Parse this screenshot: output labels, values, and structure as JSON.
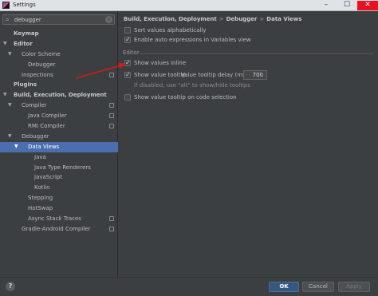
{
  "window": {
    "title": "Settings",
    "minimize": "–",
    "maximize": "☐",
    "close": "✕"
  },
  "search": {
    "value": "debugger",
    "icon": "search-icon",
    "clear": "×"
  },
  "tree": [
    {
      "label": "Keymap",
      "bold": true,
      "arrow": "",
      "indent": 0
    },
    {
      "label": "Editor",
      "bold": true,
      "arrow": "▼",
      "indent": 0
    },
    {
      "label": "Color Scheme",
      "bold": false,
      "arrow": "▼",
      "indent": 1
    },
    {
      "label": "Debugger",
      "bold": false,
      "arrow": "",
      "indent": 2
    },
    {
      "label": "Inspections",
      "bold": false,
      "arrow": "",
      "indent": 1,
      "project": true
    },
    {
      "label": "Plugins",
      "bold": true,
      "arrow": "",
      "indent": 0
    },
    {
      "label": "Build, Execution, Deployment",
      "bold": true,
      "arrow": "▼",
      "indent": 0
    },
    {
      "label": "Compiler",
      "bold": false,
      "arrow": "▼",
      "indent": 1,
      "project": true
    },
    {
      "label": "Java Compiler",
      "bold": false,
      "arrow": "",
      "indent": 2,
      "project": true
    },
    {
      "label": "RMI Compiler",
      "bold": false,
      "arrow": "",
      "indent": 2,
      "project": true
    },
    {
      "label": "Debugger",
      "bold": false,
      "arrow": "▼",
      "indent": 1
    },
    {
      "label": "Data Views",
      "bold": false,
      "arrow": "▼",
      "indent": 2,
      "selected": true
    },
    {
      "label": "Java",
      "bold": false,
      "arrow": "",
      "indent": 3
    },
    {
      "label": "Java Type Renderers",
      "bold": false,
      "arrow": "",
      "indent": 3
    },
    {
      "label": "JavaScript",
      "bold": false,
      "arrow": "",
      "indent": 3
    },
    {
      "label": "Kotlin",
      "bold": false,
      "arrow": "",
      "indent": 3
    },
    {
      "label": "Stepping",
      "bold": false,
      "arrow": "",
      "indent": 2
    },
    {
      "label": "HotSwap",
      "bold": false,
      "arrow": "",
      "indent": 2
    },
    {
      "label": "Async Stack Traces",
      "bold": false,
      "arrow": "",
      "indent": 2,
      "project": true
    },
    {
      "label": "Gradle-Android Compiler",
      "bold": false,
      "arrow": "",
      "indent": 1,
      "project": true
    }
  ],
  "breadcrumb": {
    "part1": "Build, Execution, Deployment",
    "part2": "Debugger",
    "part3": "Data Views",
    "sep": ">"
  },
  "options": {
    "sort_values": {
      "label": "Sort values alphabetically",
      "checked": false
    },
    "auto_expressions": {
      "label": "Enable auto expressions in Variables view",
      "checked": true
    }
  },
  "editor_section": {
    "title": "Editor",
    "show_inline": {
      "label": "Show values inline",
      "checked": true
    },
    "show_tooltip": {
      "label": "Show value tooltip.",
      "checked": true
    },
    "tooltip_delay_label": "Value tooltip delay (ms):",
    "tooltip_delay_value": "700",
    "hint": "If disabled, use \"alt\" to show/hide tooltips",
    "tooltip_on_selection": {
      "label": "Show value tooltip on code selection",
      "checked": false
    }
  },
  "buttons": {
    "help": "?",
    "ok": "OK",
    "cancel": "Cancel",
    "apply": "Apply"
  },
  "colors": {
    "background": "#3c3f41",
    "selection": "#4b6eaf",
    "ok_button": "#365880",
    "annotation_arrow": "#d11a1a"
  }
}
